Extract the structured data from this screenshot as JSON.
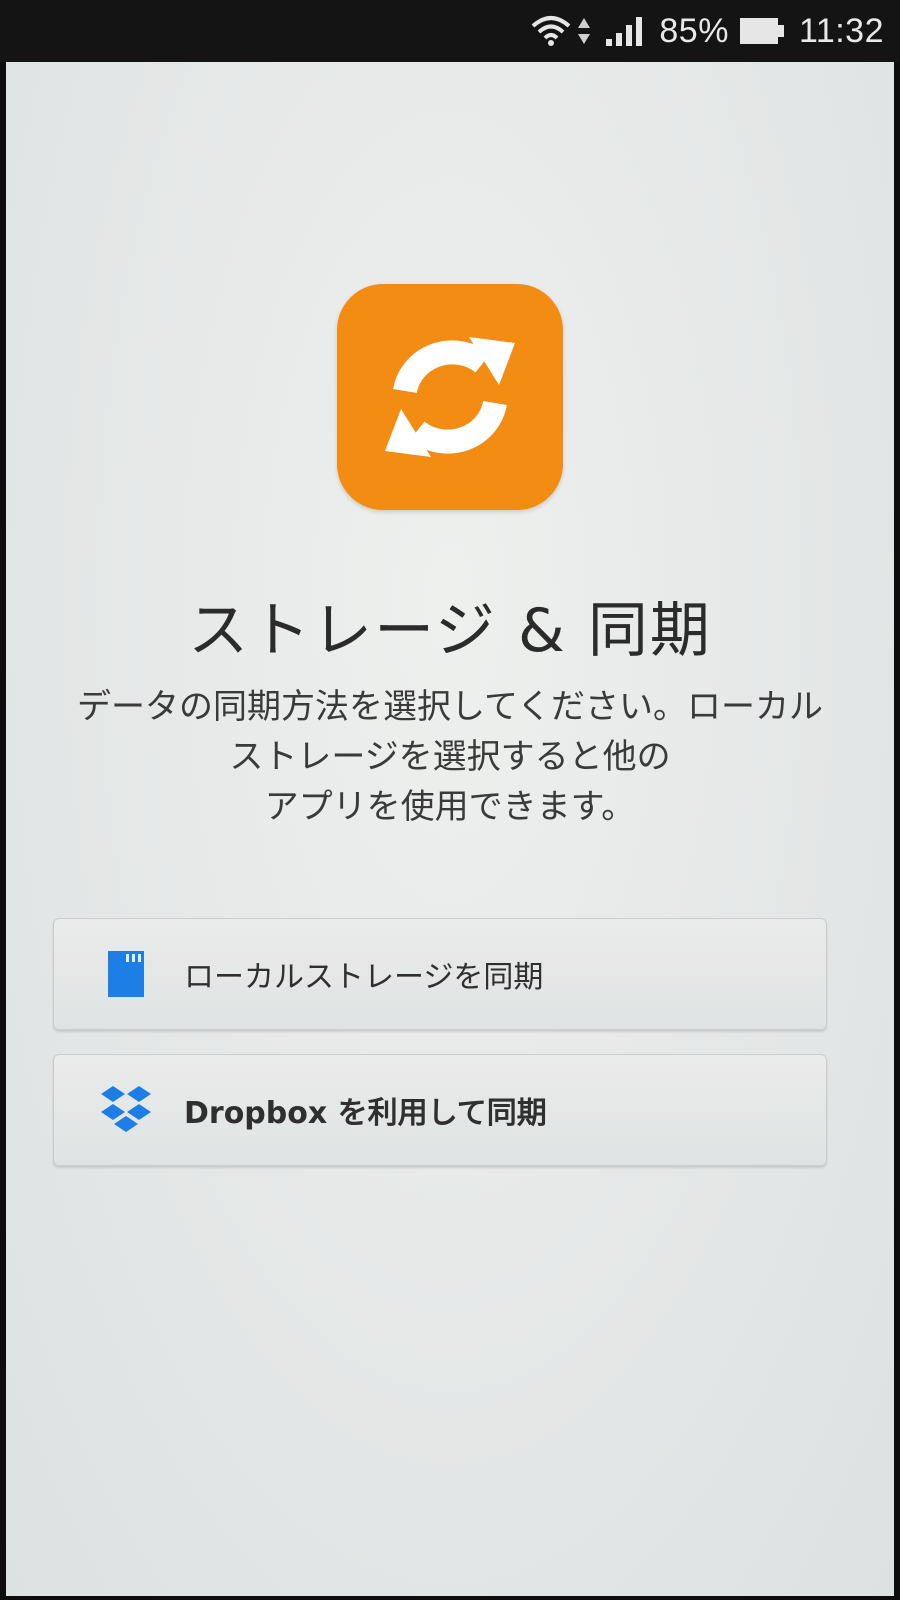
{
  "status_bar": {
    "battery": "85%",
    "time": "11:32"
  },
  "screen": {
    "title": "ストレージ & 同期",
    "description": "データの同期方法を選択してください。ローカルストレージを選択すると他の\nアプリを使用できます。",
    "options": [
      {
        "label": "ローカルストレージを同期",
        "icon": "sd-card-icon"
      },
      {
        "label": "Dropbox を利用して同期",
        "icon": "dropbox-icon"
      }
    ]
  },
  "colors": {
    "app_icon": "#f28c12",
    "accent_blue": "#1d7fe6"
  }
}
